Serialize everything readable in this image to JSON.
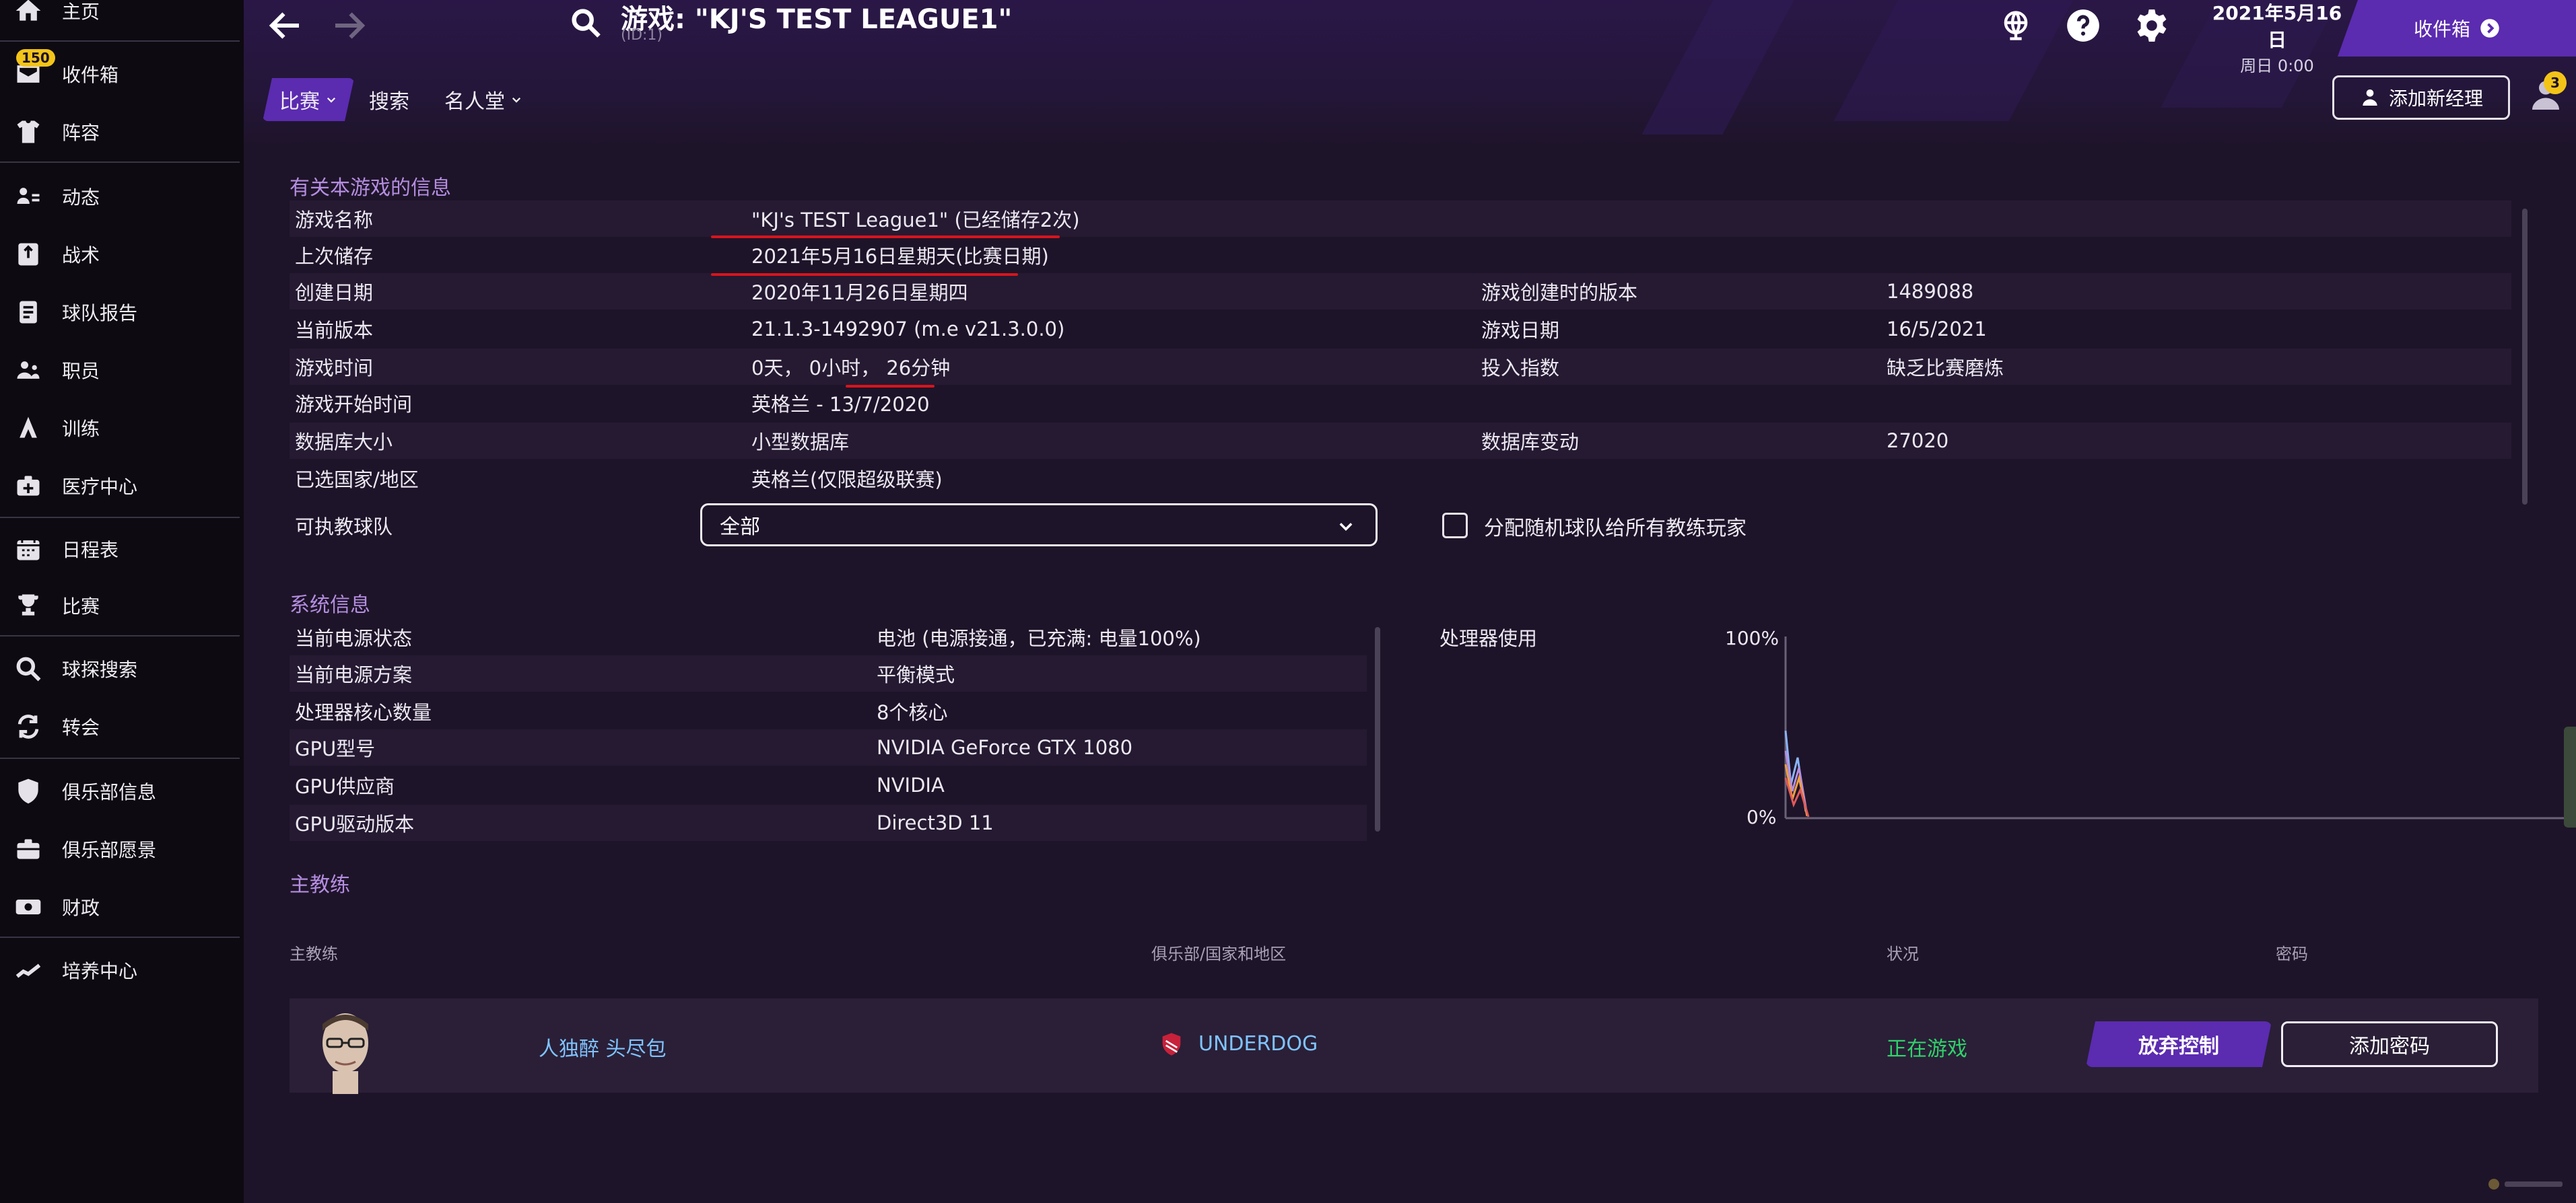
{
  "sidebar": {
    "inbox_badge": "150",
    "items": [
      {
        "label": "主页",
        "icon": "home-icon"
      },
      {
        "label": "收件箱",
        "icon": "inbox-icon"
      },
      {
        "label": "阵容",
        "icon": "squad-icon"
      },
      {
        "label": "动态",
        "icon": "dynamics-icon"
      },
      {
        "label": "战术",
        "icon": "tactics-icon"
      },
      {
        "label": "球队报告",
        "icon": "report-icon"
      },
      {
        "label": "职员",
        "icon": "staff-icon"
      },
      {
        "label": "训练",
        "icon": "training-icon"
      },
      {
        "label": "医疗中心",
        "icon": "medical-icon"
      },
      {
        "label": "日程表",
        "icon": "calendar-icon"
      },
      {
        "label": "比赛",
        "icon": "trophy-icon"
      },
      {
        "label": "球探搜索",
        "icon": "scouting-icon"
      },
      {
        "label": "转会",
        "icon": "transfer-icon"
      },
      {
        "label": "俱乐部信息",
        "icon": "club-info-icon"
      },
      {
        "label": "俱乐部愿景",
        "icon": "vision-icon"
      },
      {
        "label": "财政",
        "icon": "finance-icon"
      },
      {
        "label": "培养中心",
        "icon": "development-icon"
      }
    ]
  },
  "header": {
    "title": "游戏: \"KJ'S TEST LEAGUE1\"",
    "subtitle": "(ID:1)",
    "date_main": "2021年5月16日",
    "date_sub": "周日 0:00",
    "inbox_button": "收件箱",
    "manager_badge": "3",
    "add_manager_button": "添加新经理",
    "tabs": [
      {
        "label": "比赛",
        "active": true
      },
      {
        "label": "搜索",
        "active": false
      },
      {
        "label": "名人堂",
        "active": false
      }
    ]
  },
  "game_info": {
    "title": "有关本游戏的信息",
    "rows": [
      {
        "label": "游戏名称",
        "value": "\"KJ's TEST League1\" (已经储存2次)"
      },
      {
        "label": "上次储存",
        "value": "2021年5月16日星期天(比赛日期)"
      },
      {
        "label": "创建日期",
        "value": "2020年11月26日星期四",
        "label2": "游戏创建时的版本",
        "value2": "1489088"
      },
      {
        "label": "当前版本",
        "value": "21.1.3-1492907 (m.e v21.3.0.0)",
        "label2": "游戏日期",
        "value2": "16/5/2021"
      },
      {
        "label": "游戏时间",
        "value": "0天， 0小时， 26分钟",
        "label2": "投入指数",
        "value2": "缺乏比赛磨炼"
      },
      {
        "label": "游戏开始时间",
        "value": "英格兰 - 13/7/2020"
      },
      {
        "label": "数据库大小",
        "value": "小型数据库",
        "label2": "数据库变动",
        "value2": "27020"
      },
      {
        "label": "已选国家/地区",
        "value": "英格兰(仅限超级联赛)"
      }
    ],
    "coachable_label": "可执教球队",
    "coachable_value": "全部",
    "random_team_label": "分配随机球队给所有教练玩家"
  },
  "system_info": {
    "title": "系统信息",
    "rows": [
      {
        "label": "当前电源状态",
        "value": "电池 (电源接通，已充满: 电量100%)"
      },
      {
        "label": "当前电源方案",
        "value": "平衡模式"
      },
      {
        "label": "处理器核心数量",
        "value": "8个核心"
      },
      {
        "label": "GPU型号",
        "value": "NVIDIA GeForce GTX 1080"
      },
      {
        "label": "GPU供应商",
        "value": "NVIDIA"
      },
      {
        "label": "GPU驱动版本",
        "value": "Direct3D 11"
      }
    ],
    "cpu_label": "处理器使用",
    "cpu_axis_top": "100%",
    "cpu_axis_bottom": "0%"
  },
  "coaches": {
    "title": "主教练",
    "headers": {
      "coach": "主教练",
      "club": "俱乐部/国家和地区",
      "status": "状况",
      "password": "密码"
    },
    "rows": [
      {
        "name": "人独醉 头尽包",
        "club": "UNDERDOG",
        "status": "正在游戏",
        "release_button": "放弃控制",
        "password_button": "添加密码"
      }
    ]
  },
  "colors": {
    "accent": "#5b2bb0",
    "section_title": "#b48de0",
    "link": "#7fc3ff",
    "status_playing": "#2fd36a",
    "badge": "#f3c418",
    "annotation": "#d8141c"
  }
}
